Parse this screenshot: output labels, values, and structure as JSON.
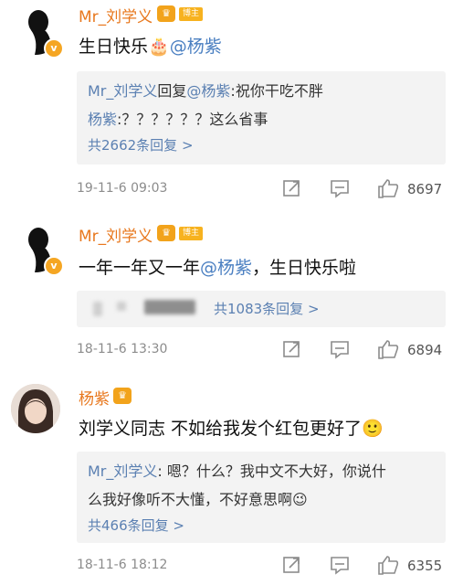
{
  "comments": [
    {
      "user": "Mr_刘学义",
      "badge_tag": "博主",
      "text_prefix": "生日快乐",
      "emoji": "🎂",
      "mention": "@杨紫",
      "replies": [
        {
          "who": "Mr_刘学义",
          "rest": "回复",
          "mention": "@杨紫",
          "text": ":祝你干吃不胖"
        },
        {
          "who": "杨紫",
          "rest": "",
          "mention": "",
          "text": ":？？？？？？这么省事"
        }
      ],
      "reply_count": "共2662条回复 >",
      "time": "19-11-6 09:03",
      "likes": "8697"
    },
    {
      "user": "Mr_刘学义",
      "badge_tag": "博主",
      "text_prefix": "一年一年又一年",
      "mention": "@杨紫",
      "text_suffix": "，生日快乐啦",
      "reply_count": "共1083条回复 >",
      "time": "18-11-6 13:30",
      "likes": "6894"
    },
    {
      "user": "杨紫",
      "text": "刘学义同志 不如给我发个红包更好了",
      "emoji": "🙂",
      "reply": {
        "who": "Mr_刘学义",
        "line1": ": 嗯？什么？我中文不大好，你说什",
        "line2": "么我好像听不大懂，不好意思啊"
      },
      "reply_emoji": "😉",
      "reply_count": "共466条回复 >",
      "time": "18-11-6 18:12",
      "likes": "6355"
    }
  ]
}
